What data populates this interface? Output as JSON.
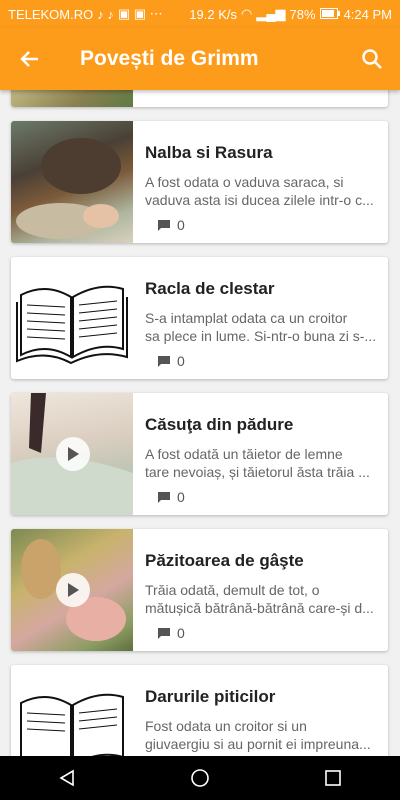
{
  "status": {
    "carrier": "TELEKOM.RO",
    "speed": "19.2 K/s",
    "battery": "78%",
    "time": "4:24 PM"
  },
  "app_bar": {
    "title": "Povești de Grimm"
  },
  "stories": [
    {
      "title": "Nalba si Rasura",
      "excerpt_l1": "A fost odata o vaduva saraca, si",
      "excerpt_l2": "vaduva asta isi ducea zilele intr-o c...",
      "comments": "0"
    },
    {
      "title": "Racla de clestar",
      "excerpt_l1": "S-a intamplat odata ca un croitor",
      "excerpt_l2": "sa plece in lume. Si-ntr-o buna zi s-...",
      "comments": "0"
    },
    {
      "title": "Căsuţa din pădure",
      "excerpt_l1": "A fost odată un tăietor de lemne",
      "excerpt_l2": "tare nevoiaș, și tăietorul ăsta trăia ...",
      "comments": "0"
    },
    {
      "title": "Păzitoarea de gâşte",
      "excerpt_l1": "Trăia odată, demult de tot, o",
      "excerpt_l2": "mătușică bătrână-bătrână care-și d...",
      "comments": "0"
    },
    {
      "title": "Darurile piticilor",
      "excerpt_l1": "Fost odata un croitor si un",
      "excerpt_l2": "giuvaergiu si au pornit ei impreuna...",
      "comments": ""
    }
  ]
}
